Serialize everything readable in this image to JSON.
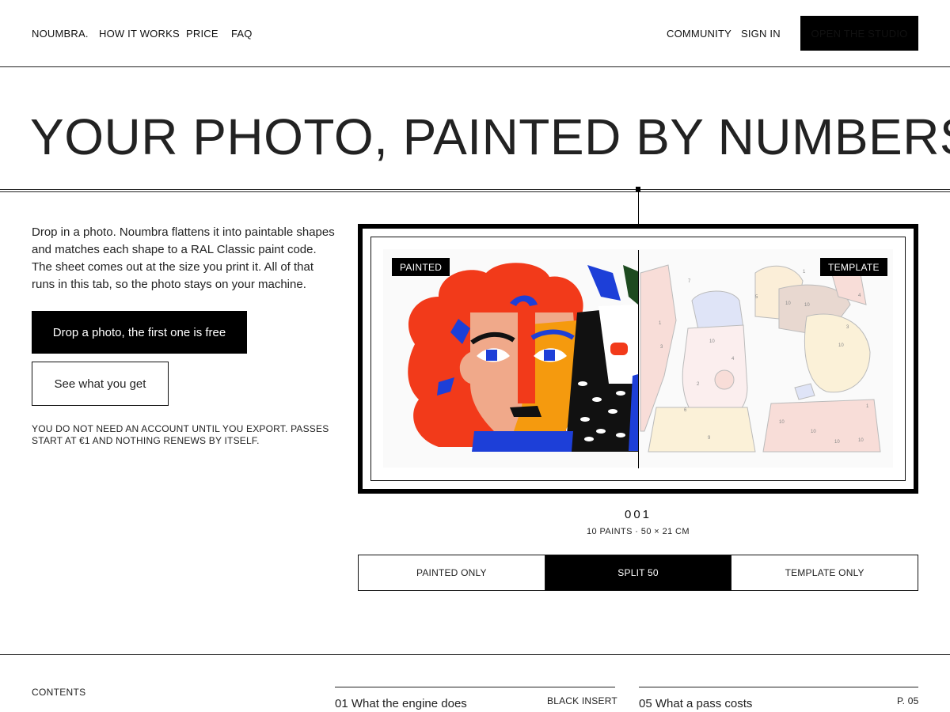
{
  "nav": {
    "brand": "NOUMBRA.",
    "links": [
      "HOW IT WORKS",
      "PRICE",
      "FAQ"
    ],
    "right_links": [
      "COMMUNITY",
      "SIGN IN"
    ],
    "cta": "OPEN THE STUDIO"
  },
  "hero": {
    "headline": "YOUR PHOTO, PAINTED BY NUMBERS.",
    "intro": "Drop in a photo. Noumbra flattens it into paintable shapes and matches each shape to a RAL Classic paint code. The sheet comes out at the size you print it. All of that runs in this tab, so the photo stays on your machine.",
    "primary_button": "Drop a photo, the first one is free",
    "secondary_button": "See what you get",
    "fine_print": "YOU DO NOT NEED AN ACCOUNT UNTIL YOU EXPORT. PASSES START AT €1 AND NOTHING RENEWS BY ITSELF."
  },
  "preview": {
    "painted_tag": "PAINTED",
    "template_tag": "TEMPLATE",
    "plate_number": "001",
    "plate_meta": "10 PAINTS · 50 × 21 CM",
    "split_percent": 50,
    "modes": [
      "PAINTED ONLY",
      "SPLIT 50",
      "TEMPLATE ONLY"
    ],
    "active_mode": "SPLIT 50",
    "template_numbers": [
      "1",
      "3",
      "7",
      "10",
      "4",
      "2",
      "5",
      "6",
      "9"
    ],
    "colors": {
      "red": "#f23a1a",
      "orange": "#f59a0e",
      "blue": "#1d3fd8",
      "skin": "#f0a98a",
      "black": "#111111",
      "green": "#1d4a1f",
      "white": "#ffffff"
    }
  },
  "contents": {
    "label": "CONTENTS",
    "items": [
      {
        "title": "01 What the engine does",
        "tag": "BLACK INSERT"
      },
      {
        "title": "05 What a pass costs",
        "tag": "P. 05"
      }
    ]
  }
}
